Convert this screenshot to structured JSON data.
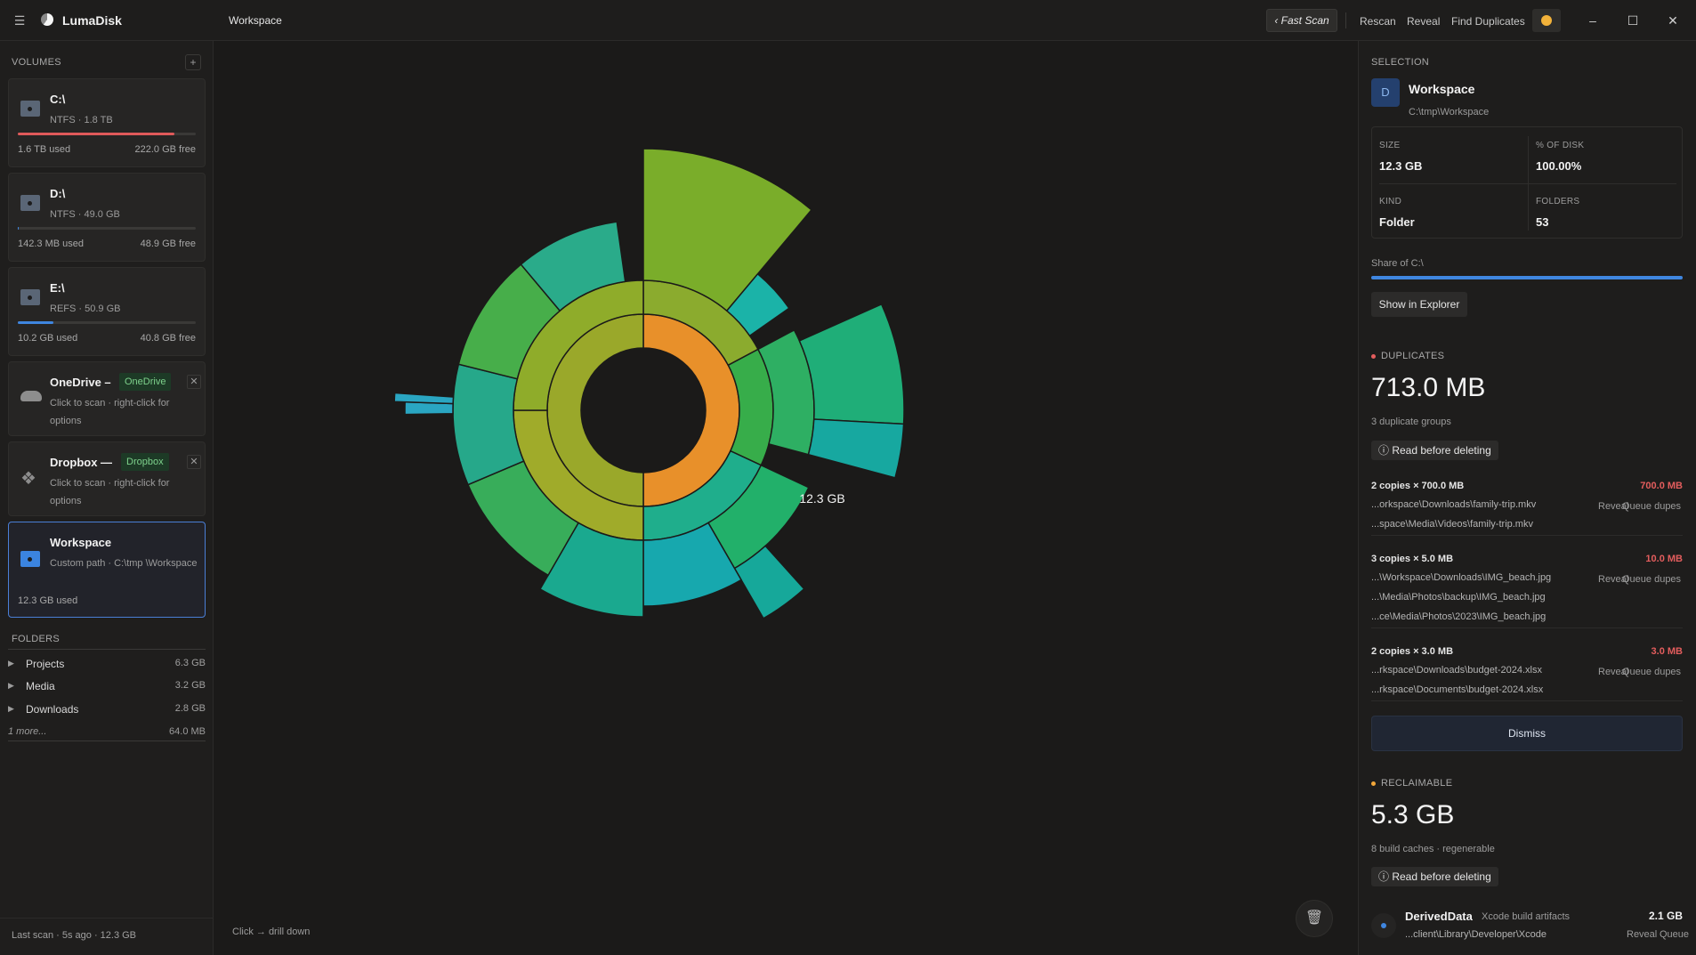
{
  "app": {
    "name": "LumaDisk",
    "breadcrumb": "Workspace"
  },
  "toolbar": {
    "fast_scan": "Fast Scan",
    "rescan": "Rescan",
    "reveal": "Reveal",
    "find_duplicates": "Find Duplicates"
  },
  "window": {
    "minimize": "–",
    "maximize": "☐",
    "close": "✕"
  },
  "sidebar": {
    "volumes_header": "VOLUMES",
    "add": "+",
    "volumes": [
      {
        "name": "C:\\",
        "sub": "NTFS · 1.8 TB",
        "used": "1.6 TB used",
        "free": "222.0 GB free",
        "used_fraction": 0.88,
        "bar_color": "#e05a5a"
      },
      {
        "name": "D:\\",
        "sub": "NTFS · 49.0 GB",
        "used": "142.3 MB used",
        "free": "48.9 GB free",
        "used_fraction": 0.003,
        "bar_color": "#3f86e0"
      },
      {
        "name": "E:\\",
        "sub": "REFS · 50.9 GB",
        "used": "10.2 GB used",
        "free": "40.8 GB free",
        "used_fraction": 0.2,
        "bar_color": "#3f86e0"
      }
    ],
    "clouds": [
      {
        "name": "OneDrive –",
        "tag": "OneDrive",
        "sub": "Click to scan · right-click for options"
      },
      {
        "name": "Dropbox —",
        "tag": "Dropbox",
        "sub": "Click to scan · right-click for options"
      }
    ],
    "workspace": {
      "name": "Workspace",
      "sub": "Custom path · C:\\tmp \\Workspace",
      "used": "12.3 GB used"
    },
    "folders_header": "FOLDERS",
    "folders": [
      {
        "name": "Projects",
        "size": "6.3 GB"
      },
      {
        "name": "Media",
        "size": "3.2 GB"
      },
      {
        "name": "Downloads",
        "size": "2.8 GB"
      }
    ],
    "more": {
      "label": "1 more...",
      "size": "64.0 MB"
    },
    "status": "Last scan · 5s ago · 12.3 GB"
  },
  "center": {
    "total": "12.3 GB",
    "hint": "Click → drill down"
  },
  "selection": {
    "header": "SELECTION",
    "badge": "D",
    "name": "Workspace",
    "path": "C:\\tmp\\Workspace",
    "size_label": "SIZE",
    "size": "12.3 GB",
    "pct_label": "% OF DISK",
    "pct": "100.00%",
    "kind_label": "KIND",
    "kind": "Folder",
    "folders_label": "FOLDERS",
    "folders": "53",
    "share_label": "Share of C:\\",
    "share_fraction": 1.0,
    "show_in_explorer": "Show in Explorer"
  },
  "duplicates": {
    "header": "DUPLICATES",
    "total": "713.0 MB",
    "groups_text": "3 duplicate groups",
    "read_before": "Read before deleting",
    "reveal": "Reveal",
    "queue": "Queue dupes",
    "groups": [
      {
        "title": "2 copies × 700.0 MB",
        "size": "700.0 MB",
        "paths": [
          "...orkspace\\Downloads\\family-trip.mkv",
          "...space\\Media\\Videos\\family-trip.mkv"
        ]
      },
      {
        "title": "3 copies × 5.0 MB",
        "size": "10.0 MB",
        "paths": [
          "...\\Workspace\\Downloads\\IMG_beach.jpg",
          "...\\Media\\Photos\\backup\\IMG_beach.jpg",
          "...ce\\Media\\Photos\\2023\\IMG_beach.jpg"
        ]
      },
      {
        "title": "2 copies × 3.0 MB",
        "size": "3.0 MB",
        "paths": [
          "...rkspace\\Downloads\\budget-2024.xlsx",
          "...rkspace\\Documents\\budget-2024.xlsx"
        ]
      }
    ],
    "dismiss": "Dismiss"
  },
  "reclaimable": {
    "header": "RECLAIMABLE",
    "total": "5.3 GB",
    "sub": "8 build caches · regenerable",
    "read_before": "Read before deleting",
    "item": {
      "name": "DerivedData",
      "desc": "Xcode build artifacts",
      "size": "2.1 GB",
      "path": "...client\\Library\\Developer\\Xcode",
      "reveal": "Reveal",
      "queue": "Queue"
    }
  },
  "colors": {
    "accent": "#3f86e0",
    "danger": "#e35d5d",
    "warning": "#f2a73a"
  }
}
